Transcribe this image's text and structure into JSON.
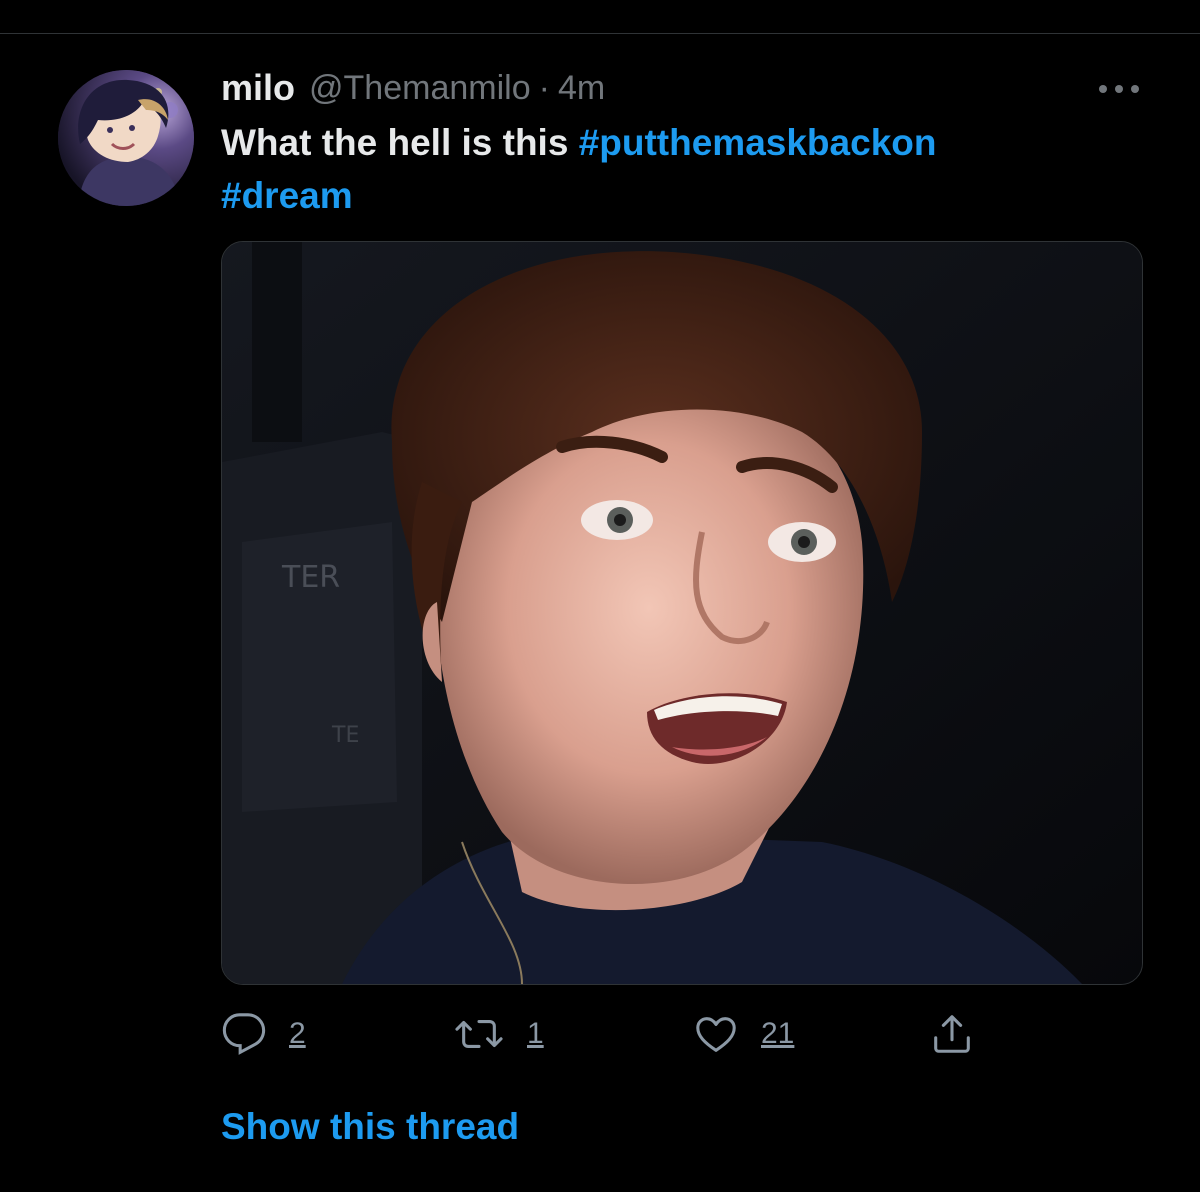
{
  "tweet": {
    "display_name": "milo",
    "handle": "@Themanmilo",
    "separator": "·",
    "timestamp": "4m",
    "text_plain": "What the hell is this ",
    "hashtags": [
      "#putthemaskbackon",
      "#dream"
    ]
  },
  "actions": {
    "reply_count": "2",
    "retweet_count": "1",
    "like_count": "21"
  },
  "show_thread_label": "Show this thread",
  "colors": {
    "background": "#000000",
    "text_primary": "#e7e9ea",
    "text_secondary": "#71767b",
    "link": "#1d9bf0",
    "divider": "#2f3336"
  },
  "icons": {
    "more": "more-dots-icon",
    "reply": "reply-bubble-icon",
    "retweet": "retweet-arrows-icon",
    "like": "heart-icon",
    "share": "share-upload-icon"
  }
}
